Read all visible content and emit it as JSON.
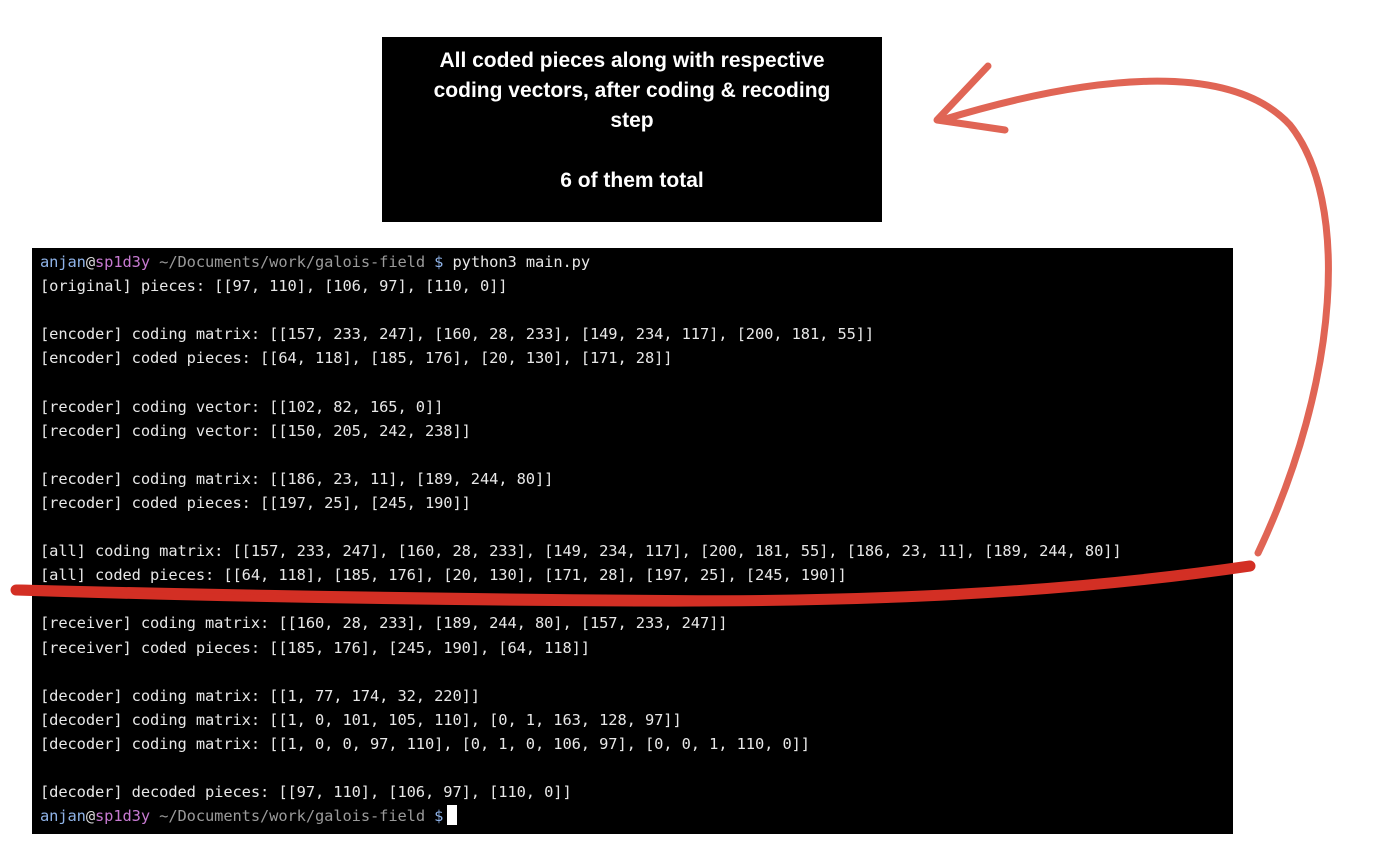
{
  "callout": {
    "line1": "All coded pieces along with respective",
    "line2": "coding vectors, after coding & recoding",
    "line3": "step",
    "line4": "6 of them total"
  },
  "prompt": {
    "user": "anjan",
    "at": "@",
    "host": "sp1d3y",
    "path": " ~/Documents/work/galois-field",
    "symbol": " $",
    "command": " python3 main.py"
  },
  "output": [
    "[original] pieces: [[97, 110], [106, 97], [110, 0]]",
    "",
    "[encoder] coding matrix: [[157, 233, 247], [160, 28, 233], [149, 234, 117], [200, 181, 55]]",
    "[encoder] coded pieces: [[64, 118], [185, 176], [20, 130], [171, 28]]",
    "",
    "[recoder] coding vector: [[102, 82, 165, 0]]",
    "[recoder] coding vector: [[150, 205, 242, 238]]",
    "",
    "[recoder] coding matrix: [[186, 23, 11], [189, 244, 80]]",
    "[recoder] coded pieces: [[197, 25], [245, 190]]",
    "",
    "[all] coding matrix: [[157, 233, 247], [160, 28, 233], [149, 234, 117], [200, 181, 55], [186, 23, 11], [189, 244, 80]]",
    "[all] coded pieces: [[64, 118], [185, 176], [20, 130], [171, 28], [197, 25], [245, 190]]",
    "",
    "[receiver] coding matrix: [[160, 28, 233], [189, 244, 80], [157, 233, 247]]",
    "[receiver] coded pieces: [[185, 176], [245, 190], [64, 118]]",
    "",
    "[decoder] coding matrix: [[1, 77, 174, 32, 220]]",
    "[decoder] coding matrix: [[1, 0, 101, 105, 110], [0, 1, 163, 128, 97]]",
    "[decoder] coding matrix: [[1, 0, 0, 97, 110], [0, 1, 0, 106, 97], [0, 0, 1, 110, 0]]",
    "",
    "[decoder] decoded pieces: [[97, 110], [106, 97], [110, 0]]"
  ],
  "colors": {
    "annotation": "#e06555",
    "underline": "#d32f24",
    "background": "#000000"
  }
}
